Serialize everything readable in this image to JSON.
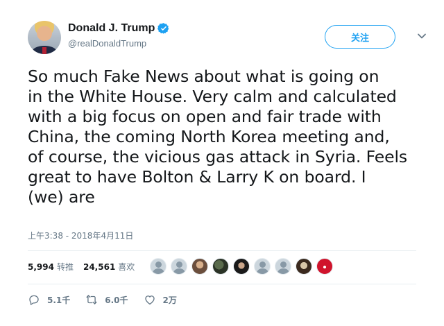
{
  "user": {
    "display_name": "Donald J. Trump",
    "handle": "@realDonaldTrump",
    "verified": true
  },
  "follow_label": "关注",
  "tweet": {
    "text": "So much Fake News about what is going on\nin the White House. Very calm and calculated\nwith a big focus on open and fair trade with\nChina, the coming North Korea meeting and,\nof course, the vicious gas attack in Syria. Feels\ngreat to have Bolton & Larry K on board. I\n(we) are",
    "timestamp": "上午3:38 - 2018年4月11日"
  },
  "stats": {
    "retweets": {
      "count": "5,994",
      "label": "转推"
    },
    "likes": {
      "count": "24,561",
      "label": "喜欢"
    }
  },
  "liker_avatars": [
    "default",
    "default",
    "photo-1",
    "photo-2",
    "photo-3",
    "default",
    "default",
    "photo-4",
    "photo-5"
  ],
  "actions": {
    "reply_count": "5.1千",
    "retweet_count": "6.0千",
    "like_count": "2万"
  },
  "colors": {
    "accent": "#1da1f2",
    "text": "#14171a",
    "muted": "#657786",
    "divider": "#e6ecf0"
  },
  "icons": [
    "verified-badge-icon",
    "chevron-down-icon",
    "reply-icon",
    "retweet-icon",
    "heart-icon"
  ]
}
